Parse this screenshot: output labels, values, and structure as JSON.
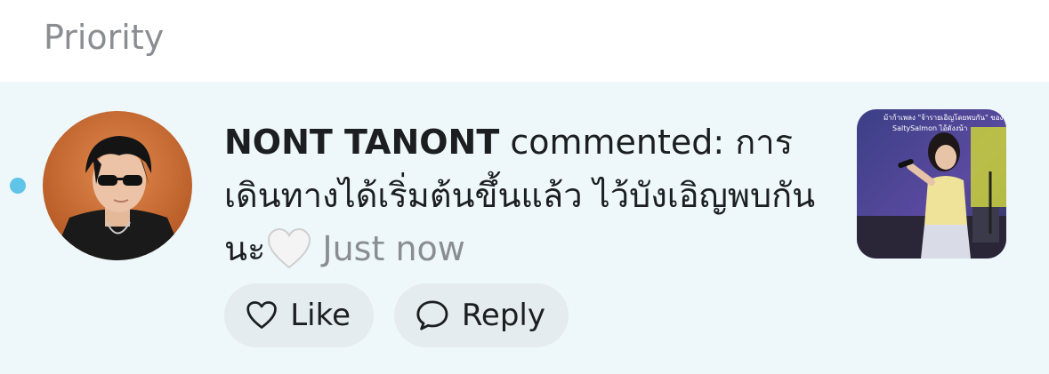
{
  "section": {
    "title": "Priority"
  },
  "notification": {
    "user_name": "NONT TANONT",
    "comment_text": "commented: การเดินทางได้เริ่มต้นขึ้นแล้ว ไว้บังเอิญพบกันนะ",
    "emoji": "white-heart-emoji",
    "time": "Just now",
    "unread": true,
    "accent_color": "#5fc4e7",
    "thumbnail_caption_line1": "ม้าก้าเพลง \"จ้ารายเอิญโดยพบกัน\" ของพ พาเรพ์",
    "thumbnail_caption_line2": "SaltySalmon ไอ้ดังงน้า"
  },
  "actions": {
    "like_label": "Like",
    "reply_label": "Reply",
    "like_icon": "heart-outline-icon",
    "reply_icon": "speech-bubble-icon"
  }
}
